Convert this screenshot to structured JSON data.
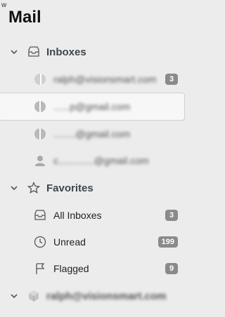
{
  "app": {
    "corner_mark": "w",
    "title": "Mail"
  },
  "inboxes": {
    "label": "Inboxes",
    "icon": "inbox-icon",
    "accounts": [
      {
        "label": "ralph@visionsmart.com",
        "badge": "3",
        "icon": "account-icon"
      },
      {
        "label": "......p@gmail.com",
        "badge": "",
        "icon": "account-icon"
      },
      {
        "label": "........@gmail.com",
        "badge": "",
        "icon": "account-icon"
      },
      {
        "label": "c.............@gmail.com",
        "badge": "",
        "icon": "person-icon"
      }
    ]
  },
  "favorites": {
    "label": "Favorites",
    "icon": "star-icon",
    "items": [
      {
        "label": "All Inboxes",
        "badge": "3",
        "icon": "inbox-icon"
      },
      {
        "label": "Unread",
        "badge": "199",
        "icon": "clock-icon"
      },
      {
        "label": "Flagged",
        "badge": "9",
        "icon": "flag-icon"
      }
    ]
  },
  "account_section": {
    "label": "ralph@visionsmart.com",
    "icon": "cube-icon"
  }
}
